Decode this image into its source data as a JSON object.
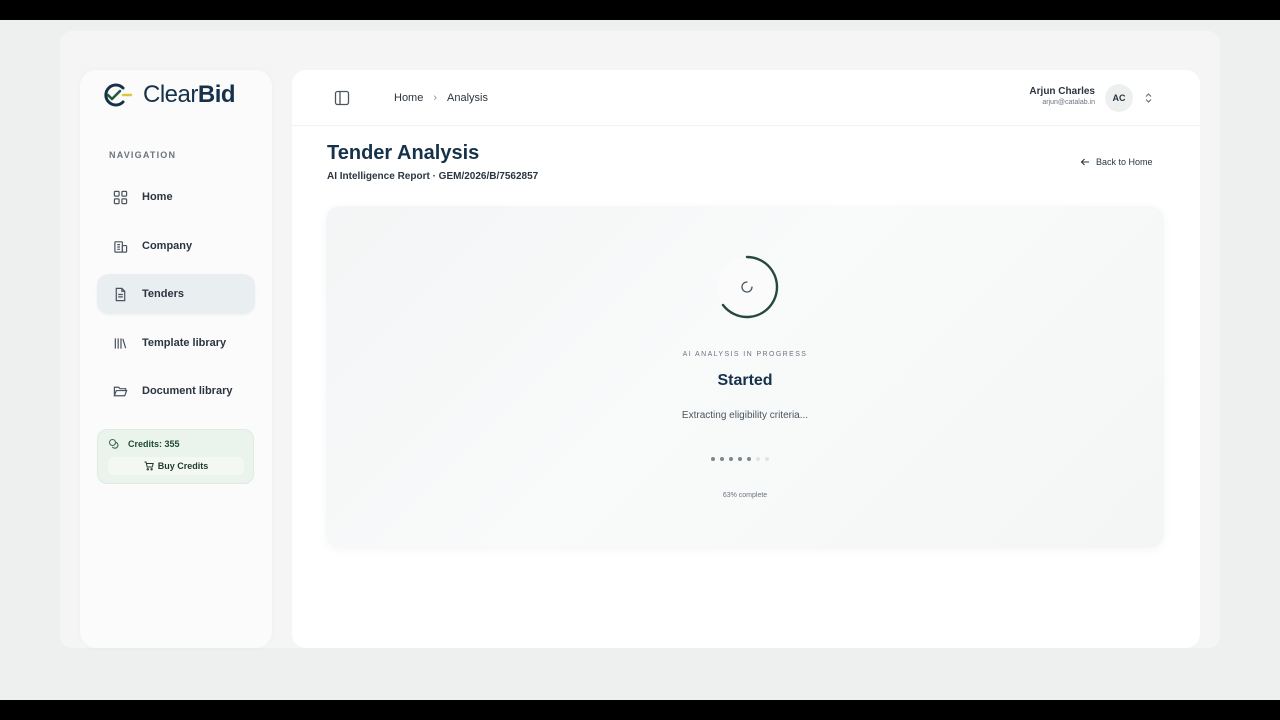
{
  "brand": {
    "name_light": "Clear",
    "name_bold": "Bid",
    "accent": "#1f5a3c",
    "check_color": "#d9c93a"
  },
  "sidebar": {
    "heading": "NAVIGATION",
    "items": [
      {
        "label": "Home",
        "icon": "grid-icon",
        "active": false
      },
      {
        "label": "Company",
        "icon": "building-icon",
        "active": false
      },
      {
        "label": "Tenders",
        "icon": "document-icon",
        "active": true
      },
      {
        "label": "Template library",
        "icon": "books-icon",
        "active": false
      },
      {
        "label": "Document library",
        "icon": "folder-open-icon",
        "active": false
      }
    ],
    "credits": {
      "label": "Credits: 355",
      "buy_label": "Buy Credits"
    }
  },
  "header": {
    "breadcrumb": [
      "Home",
      "Analysis"
    ],
    "user": {
      "name": "Arjun Charles",
      "email": "arjun@catalab.in",
      "initials": "AC"
    }
  },
  "page": {
    "title": "Tender Analysis",
    "subtitle": "AI Intelligence Report · GEM/2026/B/7562857",
    "back_label": "Back to Home"
  },
  "analysis": {
    "label": "AI ANALYSIS IN PROGRESS",
    "status": "Started",
    "detail": "Extracting eligibility criteria...",
    "steps_total": 7,
    "steps_done": 5,
    "progress_percent": 63,
    "progress_text": "63% complete"
  }
}
